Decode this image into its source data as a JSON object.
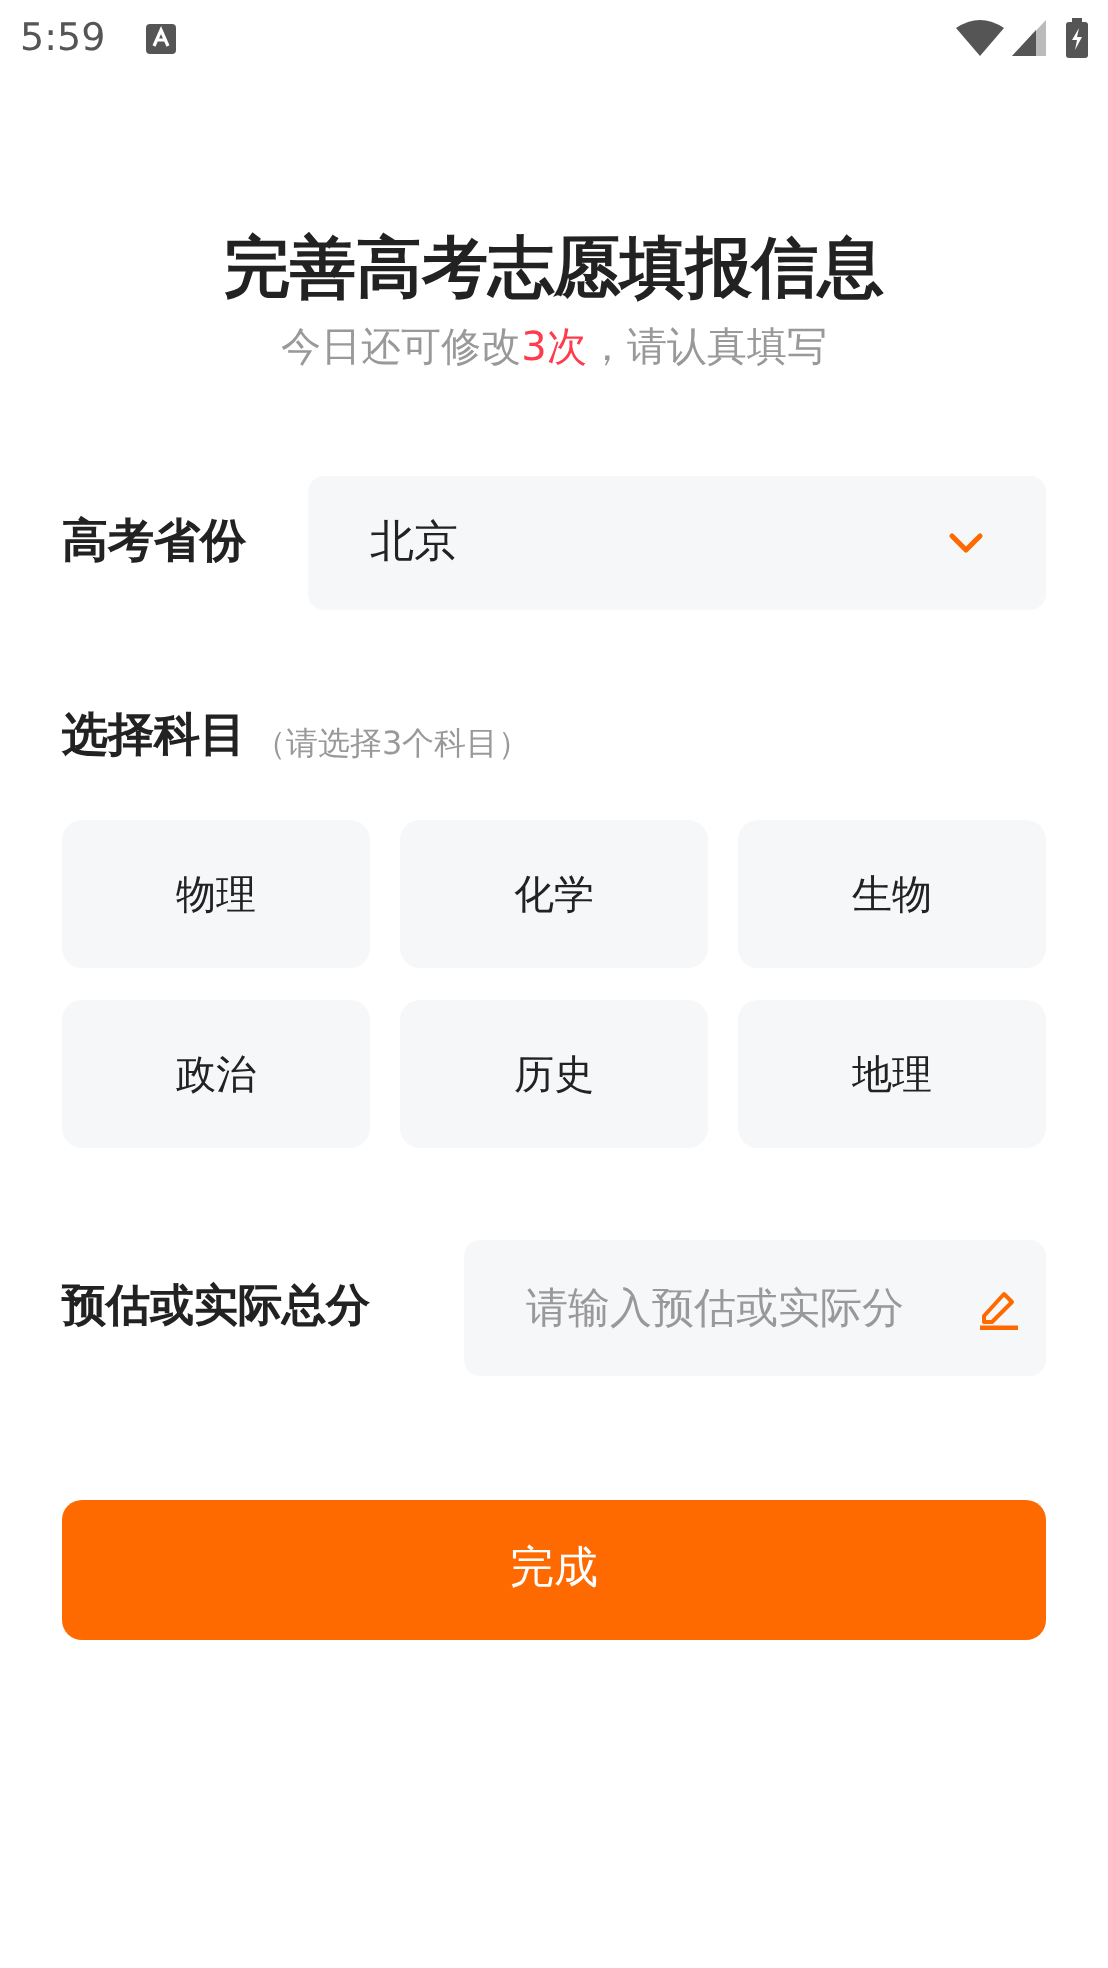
{
  "status_bar": {
    "time": "5:59"
  },
  "header": {
    "title": "完善高考志愿填报信息",
    "subtitle_parts": [
      {
        "text": "今日还可修改",
        "kind": "plain"
      },
      {
        "text": "3次",
        "kind": "highlight"
      },
      {
        "text": "，请认真填写",
        "kind": "plain"
      }
    ]
  },
  "province": {
    "label": "高考省份",
    "value": "北京"
  },
  "subjects": {
    "label": "选择科目",
    "hint": "（请选择3个科目）",
    "items": [
      {
        "label": "物理",
        "selected": false
      },
      {
        "label": "化学",
        "selected": false
      },
      {
        "label": "生物",
        "selected": false
      },
      {
        "label": "政治",
        "selected": false
      },
      {
        "label": "历史",
        "selected": false
      },
      {
        "label": "地理",
        "selected": false
      }
    ]
  },
  "score": {
    "label": "预估或实际总分",
    "placeholder": "请输入预估或实际分"
  },
  "submit": {
    "label": "完成"
  }
}
